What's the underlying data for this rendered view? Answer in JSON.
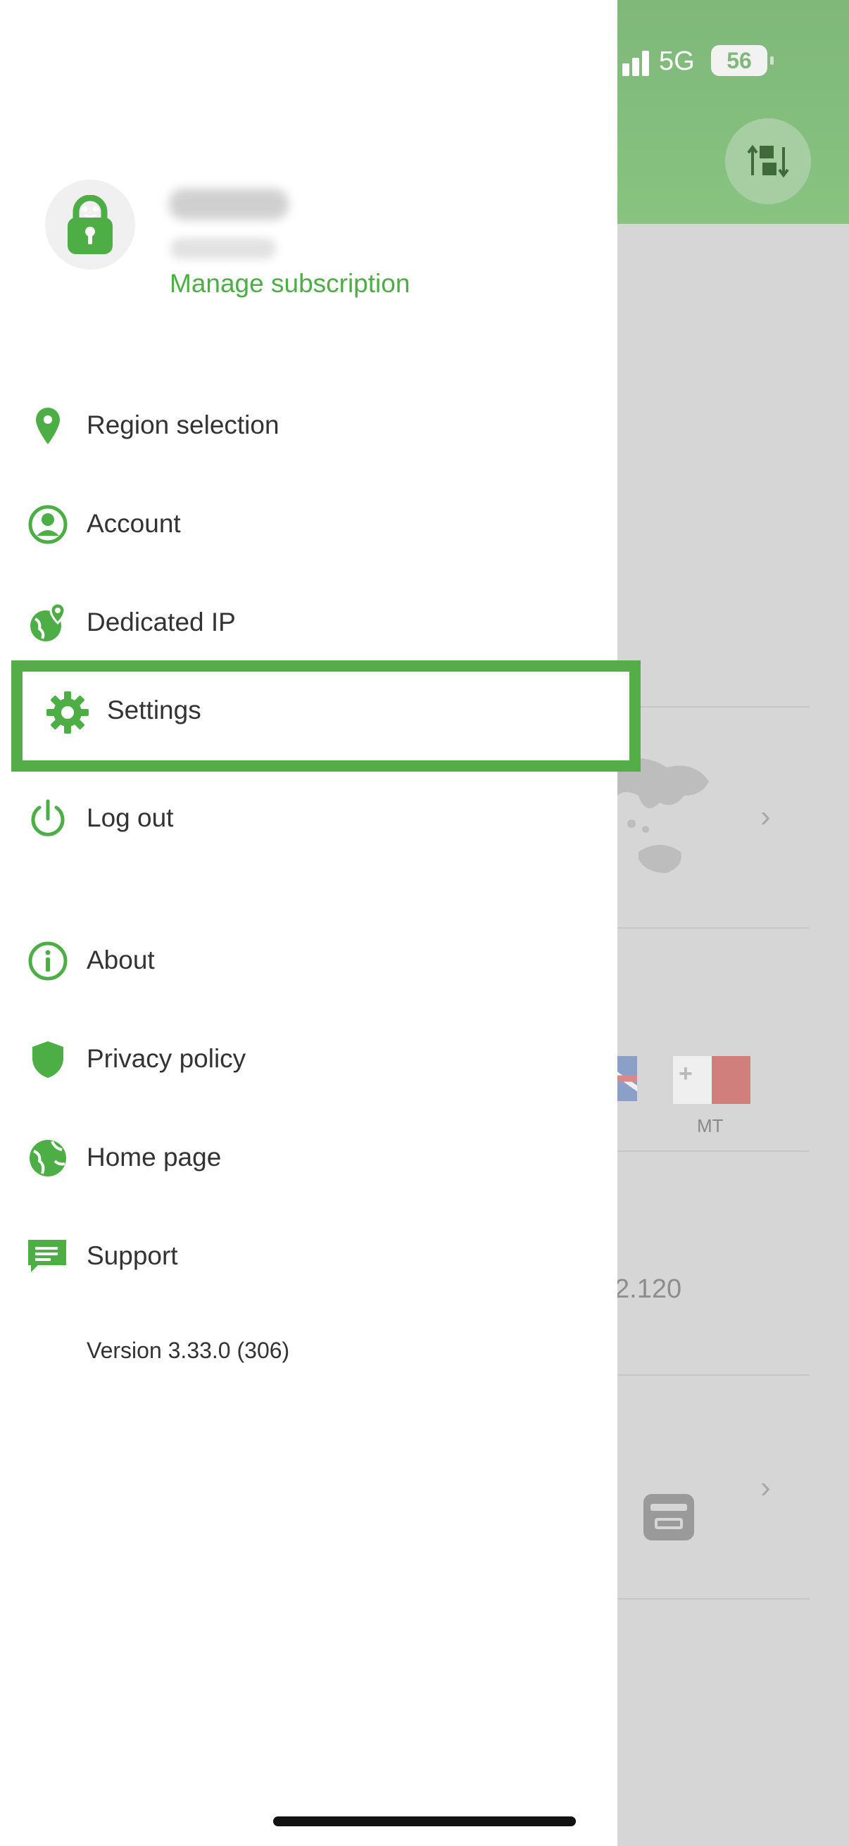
{
  "status_bar": {
    "network": "5G",
    "battery": "56"
  },
  "account": {
    "manage_subscription": "Manage subscription"
  },
  "menu": {
    "region_selection": "Region selection",
    "account": "Account",
    "dedicated_ip": "Dedicated IP",
    "settings": "Settings",
    "log_out": "Log out",
    "about": "About",
    "privacy_policy": "Privacy policy",
    "home_page": "Home page",
    "support": "Support"
  },
  "version": "Version 3.33.0 (306)",
  "background": {
    "flag_label": "MT",
    "ip_fragment": "2.120"
  },
  "colors": {
    "accent": "#4cae45",
    "highlight": "#55ad4a",
    "header": "#82bd7c"
  }
}
